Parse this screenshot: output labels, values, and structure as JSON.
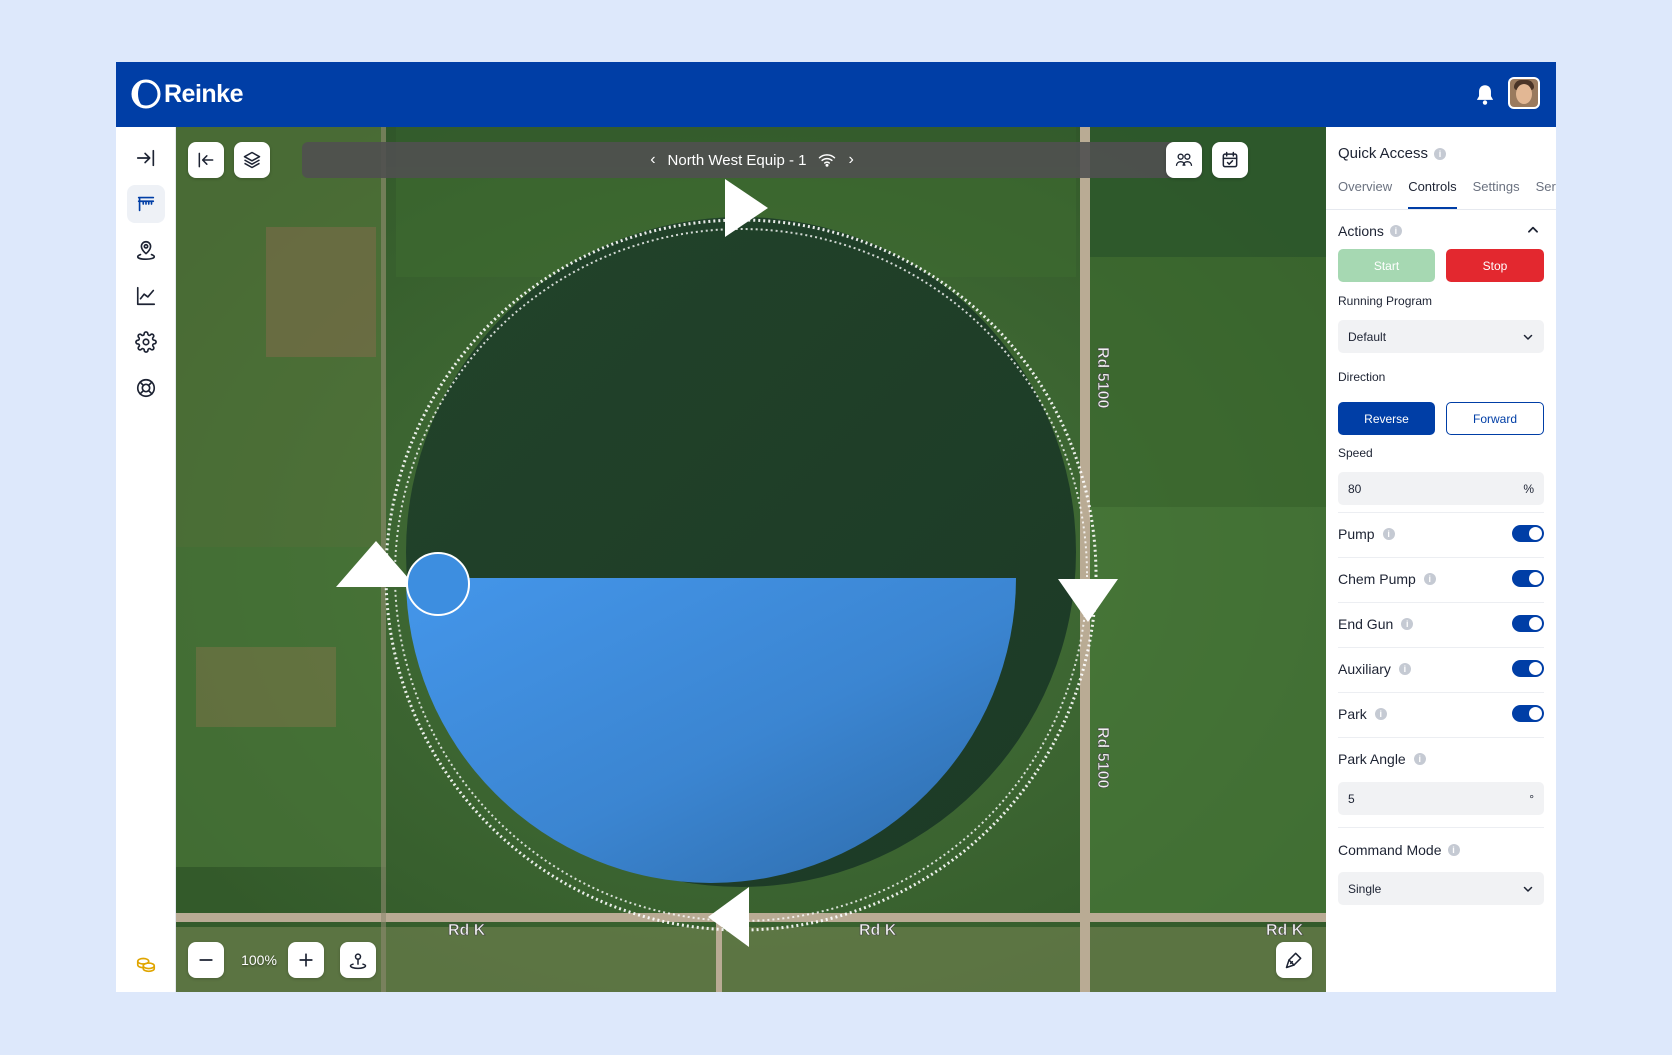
{
  "brand": {
    "name": "Reinke",
    "header_color": "#003ea6"
  },
  "header": {
    "notifications_icon": "bell-icon",
    "avatar": "user-avatar"
  },
  "nav": {
    "items": [
      {
        "name": "collapse-nav",
        "icon": "arrow-right-to-line-icon"
      },
      {
        "name": "pivots",
        "icon": "pivot-irrigation-icon",
        "active": true
      },
      {
        "name": "locations",
        "icon": "map-pin-icon"
      },
      {
        "name": "analytics",
        "icon": "line-chart-icon"
      },
      {
        "name": "settings",
        "icon": "gear-icon"
      },
      {
        "name": "support",
        "icon": "lifebuoy-icon"
      }
    ],
    "bottom_icon": "coins-icon"
  },
  "map": {
    "equipment_name": "North West Equip - 1",
    "zoom_level": "100%",
    "road_labels": [
      "Rd 5100",
      "Rd 5100",
      "Rd K",
      "Rd K",
      "Rd K"
    ],
    "applied_color": "#3d8ee0"
  },
  "panel": {
    "title": "Quick Access",
    "tabs": [
      "Overview",
      "Controls",
      "Settings",
      "Ser"
    ],
    "active_tab": "Controls",
    "actions": {
      "title": "Actions",
      "start_label": "Start",
      "stop_label": "Stop"
    },
    "running_program": {
      "label": "Running Program",
      "value": "Default"
    },
    "direction": {
      "label": "Direction",
      "reverse_label": "Reverse",
      "forward_label": "Forward",
      "selected": "Reverse"
    },
    "speed": {
      "label": "Speed",
      "value": "80",
      "suffix": "%"
    },
    "toggles": [
      {
        "label": "Pump",
        "on": true
      },
      {
        "label": "Chem Pump",
        "on": true
      },
      {
        "label": "End Gun",
        "on": true
      },
      {
        "label": "Auxiliary",
        "on": true
      },
      {
        "label": "Park",
        "on": true
      }
    ],
    "park_angle": {
      "label": "Park Angle",
      "value": "5",
      "suffix": "°"
    },
    "command_mode": {
      "label": "Command Mode",
      "value": "Single"
    }
  }
}
